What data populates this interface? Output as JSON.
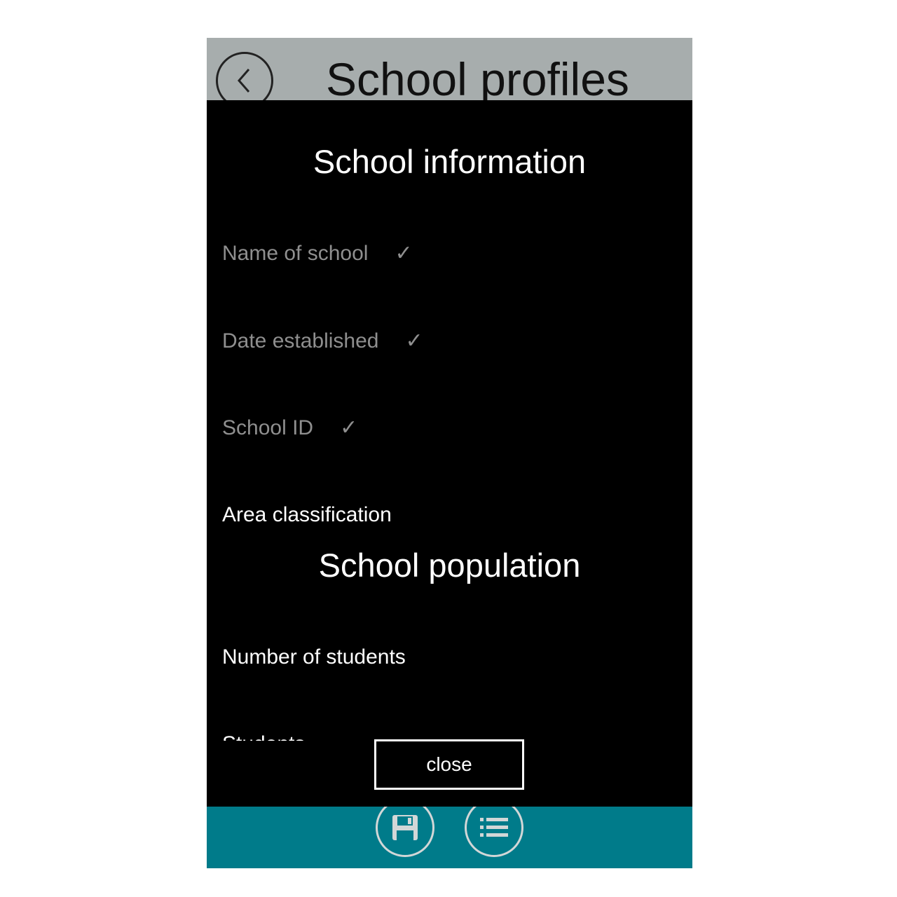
{
  "header": {
    "title": "School profiles",
    "back_icon": "chevron-left-icon"
  },
  "modal": {
    "sections": [
      {
        "title": "School information"
      },
      {
        "title": "School population"
      }
    ],
    "fields": [
      {
        "label": "Name of school",
        "check": "✓"
      },
      {
        "label": "Date established",
        "check": "✓"
      },
      {
        "label": "School ID",
        "check": "✓"
      },
      {
        "label": "Area classification"
      },
      {
        "label": "Number of students"
      }
    ],
    "close_label": "close"
  },
  "footer": {
    "save_icon": "floppy-disk-icon",
    "list_icon": "list-icon"
  },
  "colors": {
    "header_bg": "#a7adad",
    "modal_bg": "#000000",
    "footer_bg": "#007b8a",
    "completed_text": "#8f8f8f"
  }
}
